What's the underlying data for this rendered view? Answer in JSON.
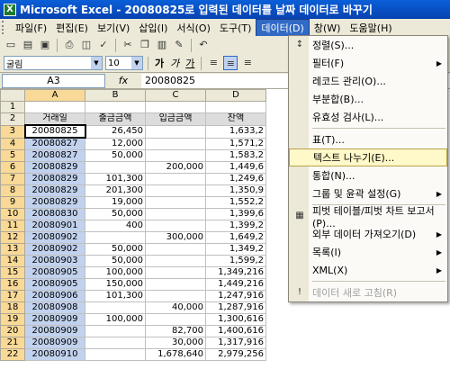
{
  "window": {
    "title": "Microsoft Excel - 20080825로 입력된 데이터를 날짜 데이터로 바꾸기"
  },
  "menubar": {
    "items": [
      "파일(F)",
      "편집(E)",
      "보기(V)",
      "삽입(I)",
      "서식(O)",
      "도구(T)",
      "데이터(D)",
      "창(W)",
      "도움말(H)"
    ]
  },
  "toolbar": {
    "font": "굴림",
    "size": "10",
    "bold": "가",
    "italic": "가",
    "underline": "가"
  },
  "formula_bar": {
    "name_box": "A3",
    "fx": "fx",
    "value": "20080825"
  },
  "sheet": {
    "columns": [
      "A",
      "B",
      "C",
      "D"
    ],
    "rows": [
      {
        "n": "1",
        "a": "",
        "b": "",
        "c": "",
        "d": ""
      },
      {
        "n": "2",
        "a": "거래일",
        "b": "출금금액",
        "c": "입금금액",
        "d": "잔액"
      },
      {
        "n": "3",
        "a": "20080825",
        "b": "26,450",
        "c": "",
        "d": "1,633,2"
      },
      {
        "n": "4",
        "a": "20080827",
        "b": "12,000",
        "c": "",
        "d": "1,571,2"
      },
      {
        "n": "5",
        "a": "20080827",
        "b": "50,000",
        "c": "",
        "d": "1,583,2"
      },
      {
        "n": "6",
        "a": "20080829",
        "b": "",
        "c": "200,000",
        "d": "1,449,6"
      },
      {
        "n": "7",
        "a": "20080829",
        "b": "101,300",
        "c": "",
        "d": "1,249,6"
      },
      {
        "n": "8",
        "a": "20080829",
        "b": "201,300",
        "c": "",
        "d": "1,350,9"
      },
      {
        "n": "9",
        "a": "20080829",
        "b": "19,000",
        "c": "",
        "d": "1,552,2"
      },
      {
        "n": "10",
        "a": "20080830",
        "b": "50,000",
        "c": "",
        "d": "1,399,6"
      },
      {
        "n": "11",
        "a": "20080901",
        "b": "400",
        "c": "",
        "d": "1,399,2"
      },
      {
        "n": "12",
        "a": "20080902",
        "b": "",
        "c": "300,000",
        "d": "1,649,2"
      },
      {
        "n": "13",
        "a": "20080902",
        "b": "50,000",
        "c": "",
        "d": "1,349,2"
      },
      {
        "n": "14",
        "a": "20080903",
        "b": "50,000",
        "c": "",
        "d": "1,599,2"
      },
      {
        "n": "15",
        "a": "20080905",
        "b": "100,000",
        "c": "",
        "d": "1,349,216"
      },
      {
        "n": "16",
        "a": "20080905",
        "b": "150,000",
        "c": "",
        "d": "1,449,216"
      },
      {
        "n": "17",
        "a": "20080906",
        "b": "101,300",
        "c": "",
        "d": "1,247,916"
      },
      {
        "n": "18",
        "a": "20080908",
        "b": "",
        "c": "40,000",
        "d": "1,287,916"
      },
      {
        "n": "19",
        "a": "20080909",
        "b": "100,000",
        "c": "",
        "d": "1,300,616"
      },
      {
        "n": "20",
        "a": "20080909",
        "b": "",
        "c": "82,700",
        "d": "1,400,616"
      },
      {
        "n": "21",
        "a": "20080909",
        "b": "",
        "c": "30,000",
        "d": "1,317,916"
      },
      {
        "n": "22",
        "a": "20080910",
        "b": "",
        "c": "1,678,640",
        "d": "2,979,256"
      }
    ]
  },
  "data_menu": {
    "items": [
      {
        "label": "정렬(S)...",
        "icon": "sort-icon",
        "glyph": "↕",
        "sub": false
      },
      {
        "label": "필터(F)",
        "icon": "",
        "glyph": "",
        "sub": true
      },
      {
        "label": "레코드 관리(O)...",
        "icon": "",
        "glyph": "",
        "sub": false
      },
      {
        "label": "부분합(B)...",
        "icon": "",
        "glyph": "",
        "sub": false
      },
      {
        "label": "유효성 검사(L)...",
        "icon": "",
        "glyph": "",
        "sub": false
      },
      {
        "sep": true
      },
      {
        "label": "표(T)...",
        "icon": "",
        "glyph": "",
        "sub": false
      },
      {
        "label": "텍스트 나누기(E)...",
        "icon": "",
        "glyph": "",
        "sub": false,
        "highlight": true
      },
      {
        "label": "통합(N)...",
        "icon": "",
        "glyph": "",
        "sub": false
      },
      {
        "label": "그룹 및 윤곽 설정(G)",
        "icon": "",
        "glyph": "",
        "sub": true
      },
      {
        "sep": true
      },
      {
        "label": "피벗 테이블/피벗 차트 보고서(P)...",
        "icon": "pivot-table-icon",
        "glyph": "▦",
        "sub": false
      },
      {
        "label": "외부 데이터 가져오기(D)",
        "icon": "",
        "glyph": "",
        "sub": true
      },
      {
        "label": "목록(I)",
        "icon": "",
        "glyph": "",
        "sub": true
      },
      {
        "label": "XML(X)",
        "icon": "",
        "glyph": "",
        "sub": true
      },
      {
        "sep": true
      },
      {
        "label": "데이터 새로 고침(R)",
        "icon": "refresh-icon",
        "glyph": "!",
        "sub": false,
        "disabled": true
      }
    ]
  }
}
